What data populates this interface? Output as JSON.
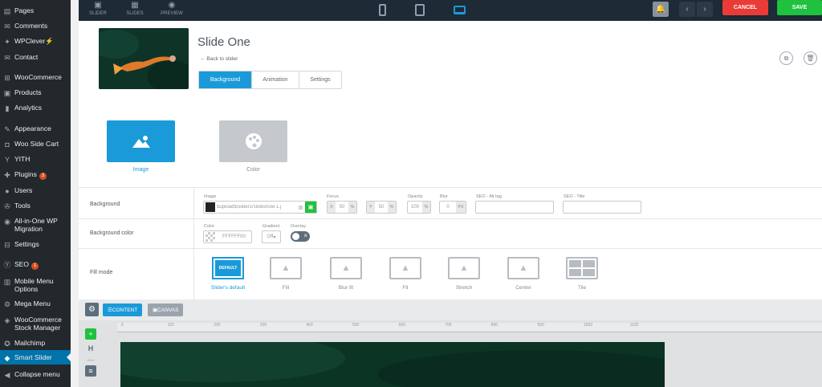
{
  "wp_sidebar": {
    "items": [
      {
        "label": "Pages",
        "icon": "pages-icon",
        "glyph": "▤"
      },
      {
        "label": "Comments",
        "icon": "comments-icon",
        "glyph": "✉"
      },
      {
        "label": "WPClever",
        "icon": "wpclever-icon",
        "glyph": "✦",
        "suffix": "⚡"
      },
      {
        "label": "Contact",
        "icon": "contact-icon",
        "glyph": "✉"
      },
      {
        "label": "WooCommerce",
        "icon": "woocommerce-icon",
        "glyph": "⊞"
      },
      {
        "label": "Products",
        "icon": "products-icon",
        "glyph": "▣"
      },
      {
        "label": "Analytics",
        "icon": "analytics-icon",
        "glyph": "▮"
      },
      {
        "label": "Appearance",
        "icon": "appearance-icon",
        "glyph": "✎"
      },
      {
        "label": "Woo Side Cart",
        "icon": "side-cart-icon",
        "glyph": "◘"
      },
      {
        "label": "YITH",
        "icon": "yith-icon",
        "glyph": "Y"
      },
      {
        "label": "Plugins",
        "icon": "plugins-icon",
        "glyph": "✚",
        "badge": "3"
      },
      {
        "label": "Users",
        "icon": "users-icon",
        "glyph": "●"
      },
      {
        "label": "Tools",
        "icon": "tools-icon",
        "glyph": "✇"
      },
      {
        "label": "All-in-One WP Migration",
        "icon": "migration-icon",
        "glyph": "◉"
      },
      {
        "label": "Settings",
        "icon": "settings-icon",
        "glyph": "⊟"
      },
      {
        "label": "SEO",
        "icon": "seo-icon",
        "glyph": "Ⓨ",
        "badge": "1"
      },
      {
        "label": "Mobile Menu Options",
        "icon": "mobile-menu-icon",
        "glyph": "▥"
      },
      {
        "label": "Mega Menu",
        "icon": "mega-menu-icon",
        "glyph": "⚙"
      },
      {
        "label": "WooCommerce Stock Manager",
        "icon": "stock-manager-icon",
        "glyph": "◈"
      },
      {
        "label": "Mailchimp",
        "icon": "mailchimp-icon",
        "glyph": "✪"
      },
      {
        "label": "Smart Slider",
        "icon": "smart-slider-icon",
        "glyph": "◆"
      },
      {
        "label": "Collapse menu",
        "icon": "collapse-icon",
        "glyph": "◀"
      }
    ]
  },
  "topbar": {
    "slider_label": "SLIDER",
    "slides_label": "SLIDES",
    "preview_label": "PREVIEW",
    "cancel_label": "CANCEL",
    "save_label": "SAVE"
  },
  "slide": {
    "title": "Slide One",
    "back_label": "Back to slider",
    "tabs": [
      "Background",
      "Animation",
      "Settings"
    ]
  },
  "bg_types": {
    "image_label": "Image",
    "color_label": "Color"
  },
  "background_row": {
    "label": "Background",
    "image_label": "Image",
    "image_value": "$upload$/slider1/slideshow-1.j",
    "focus_label": "Focus",
    "focus_x_prefix": "X",
    "focus_x": "50",
    "focus_y_prefix": "Y",
    "focus_y": "50",
    "unit_pct": "%",
    "opacity_label": "Opacity",
    "opacity": "100",
    "blur_label": "Blur",
    "blur": "0",
    "blur_unit": "PX",
    "alt_label": "SEO - Alt tag",
    "title_label": "SEO - Title"
  },
  "bgcolor_row": {
    "label": "Background color",
    "color_label": "Color",
    "color_value": "FFFFFF00",
    "gradient_label": "Gradient",
    "gradient_value": "Off",
    "overlay_label": "Overlay"
  },
  "fillmode_row": {
    "label": "Fill mode",
    "default_badge": "DEFAULT",
    "modes": [
      "Slider's default",
      "Fill",
      "Blur fit",
      "Fit",
      "Stretch",
      "Center",
      "Tile"
    ]
  },
  "editor_toolbar": {
    "content_label": "CONTENT",
    "canvas_label": "CANVAS"
  },
  "ruler": [
    "0",
    "100",
    "200",
    "300",
    "400",
    "500",
    "600",
    "700",
    "800",
    "900",
    "1000",
    "1100"
  ],
  "colors": {
    "accent": "#1a9ad9",
    "cancel": "#ea3b36",
    "save": "#1fc13e",
    "wp_sidebar": "#23282d",
    "wp_active": "#0073aa"
  }
}
